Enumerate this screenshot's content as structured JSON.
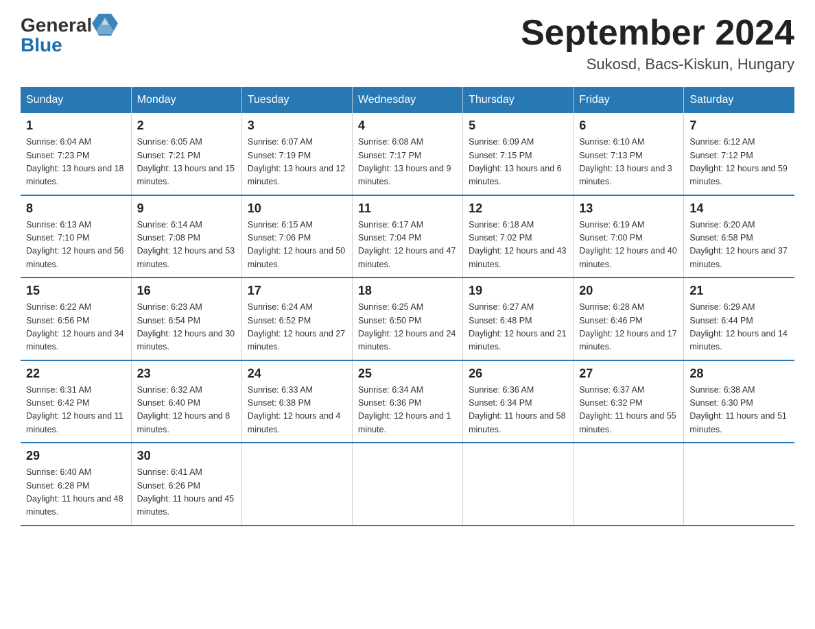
{
  "logo": {
    "general": "General",
    "blue": "Blue"
  },
  "title": "September 2024",
  "location": "Sukosd, Bacs-Kiskun, Hungary",
  "days_of_week": [
    "Sunday",
    "Monday",
    "Tuesday",
    "Wednesday",
    "Thursday",
    "Friday",
    "Saturday"
  ],
  "weeks": [
    [
      {
        "day": "1",
        "sunrise": "6:04 AM",
        "sunset": "7:23 PM",
        "daylight": "13 hours and 18 minutes."
      },
      {
        "day": "2",
        "sunrise": "6:05 AM",
        "sunset": "7:21 PM",
        "daylight": "13 hours and 15 minutes."
      },
      {
        "day": "3",
        "sunrise": "6:07 AM",
        "sunset": "7:19 PM",
        "daylight": "13 hours and 12 minutes."
      },
      {
        "day": "4",
        "sunrise": "6:08 AM",
        "sunset": "7:17 PM",
        "daylight": "13 hours and 9 minutes."
      },
      {
        "day": "5",
        "sunrise": "6:09 AM",
        "sunset": "7:15 PM",
        "daylight": "13 hours and 6 minutes."
      },
      {
        "day": "6",
        "sunrise": "6:10 AM",
        "sunset": "7:13 PM",
        "daylight": "13 hours and 3 minutes."
      },
      {
        "day": "7",
        "sunrise": "6:12 AM",
        "sunset": "7:12 PM",
        "daylight": "12 hours and 59 minutes."
      }
    ],
    [
      {
        "day": "8",
        "sunrise": "6:13 AM",
        "sunset": "7:10 PM",
        "daylight": "12 hours and 56 minutes."
      },
      {
        "day": "9",
        "sunrise": "6:14 AM",
        "sunset": "7:08 PM",
        "daylight": "12 hours and 53 minutes."
      },
      {
        "day": "10",
        "sunrise": "6:15 AM",
        "sunset": "7:06 PM",
        "daylight": "12 hours and 50 minutes."
      },
      {
        "day": "11",
        "sunrise": "6:17 AM",
        "sunset": "7:04 PM",
        "daylight": "12 hours and 47 minutes."
      },
      {
        "day": "12",
        "sunrise": "6:18 AM",
        "sunset": "7:02 PM",
        "daylight": "12 hours and 43 minutes."
      },
      {
        "day": "13",
        "sunrise": "6:19 AM",
        "sunset": "7:00 PM",
        "daylight": "12 hours and 40 minutes."
      },
      {
        "day": "14",
        "sunrise": "6:20 AM",
        "sunset": "6:58 PM",
        "daylight": "12 hours and 37 minutes."
      }
    ],
    [
      {
        "day": "15",
        "sunrise": "6:22 AM",
        "sunset": "6:56 PM",
        "daylight": "12 hours and 34 minutes."
      },
      {
        "day": "16",
        "sunrise": "6:23 AM",
        "sunset": "6:54 PM",
        "daylight": "12 hours and 30 minutes."
      },
      {
        "day": "17",
        "sunrise": "6:24 AM",
        "sunset": "6:52 PM",
        "daylight": "12 hours and 27 minutes."
      },
      {
        "day": "18",
        "sunrise": "6:25 AM",
        "sunset": "6:50 PM",
        "daylight": "12 hours and 24 minutes."
      },
      {
        "day": "19",
        "sunrise": "6:27 AM",
        "sunset": "6:48 PM",
        "daylight": "12 hours and 21 minutes."
      },
      {
        "day": "20",
        "sunrise": "6:28 AM",
        "sunset": "6:46 PM",
        "daylight": "12 hours and 17 minutes."
      },
      {
        "day": "21",
        "sunrise": "6:29 AM",
        "sunset": "6:44 PM",
        "daylight": "12 hours and 14 minutes."
      }
    ],
    [
      {
        "day": "22",
        "sunrise": "6:31 AM",
        "sunset": "6:42 PM",
        "daylight": "12 hours and 11 minutes."
      },
      {
        "day": "23",
        "sunrise": "6:32 AM",
        "sunset": "6:40 PM",
        "daylight": "12 hours and 8 minutes."
      },
      {
        "day": "24",
        "sunrise": "6:33 AM",
        "sunset": "6:38 PM",
        "daylight": "12 hours and 4 minutes."
      },
      {
        "day": "25",
        "sunrise": "6:34 AM",
        "sunset": "6:36 PM",
        "daylight": "12 hours and 1 minute."
      },
      {
        "day": "26",
        "sunrise": "6:36 AM",
        "sunset": "6:34 PM",
        "daylight": "11 hours and 58 minutes."
      },
      {
        "day": "27",
        "sunrise": "6:37 AM",
        "sunset": "6:32 PM",
        "daylight": "11 hours and 55 minutes."
      },
      {
        "day": "28",
        "sunrise": "6:38 AM",
        "sunset": "6:30 PM",
        "daylight": "11 hours and 51 minutes."
      }
    ],
    [
      {
        "day": "29",
        "sunrise": "6:40 AM",
        "sunset": "6:28 PM",
        "daylight": "11 hours and 48 minutes."
      },
      {
        "day": "30",
        "sunrise": "6:41 AM",
        "sunset": "6:26 PM",
        "daylight": "11 hours and 45 minutes."
      },
      null,
      null,
      null,
      null,
      null
    ]
  ],
  "labels": {
    "sunrise": "Sunrise:",
    "sunset": "Sunset:",
    "daylight": "Daylight:"
  }
}
